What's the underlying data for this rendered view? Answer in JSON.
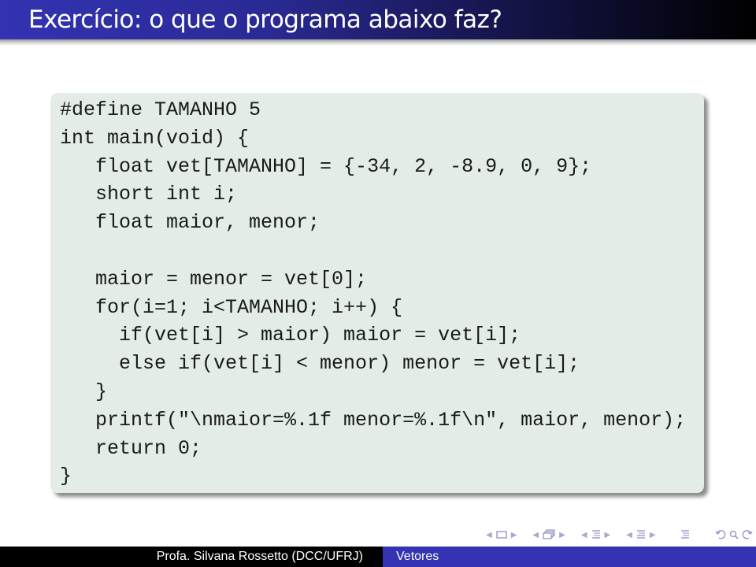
{
  "slide": {
    "title": "Exercício: o que o programa abaixo faz?",
    "code_lines": [
      "#define TAMANHO 5",
      "int main(void) {",
      "   float vet[TAMANHO] = {-34, 2, -8.9, 0, 9};",
      "   short int i;",
      "   float maior, menor;",
      "",
      "   maior = menor = vet[0];",
      "   for(i=1; i<TAMANHO; i++) {",
      "     if(vet[i] > maior) maior = vet[i];",
      "     else if(vet[i] < menor) menor = vet[i];",
      "   }",
      "   printf(\"\\nmaior=%.1f menor=%.1f\\n\", maior, menor);",
      "   return 0;",
      "}"
    ]
  },
  "navigation": {
    "icons": [
      "frame-icon",
      "subsection-icon",
      "section-icon",
      "document-icon",
      "outline-icon",
      "back-icon",
      "search-icon",
      "forward-icon"
    ]
  },
  "footer": {
    "author": "Profa. Silvana Rossetto (DCC/UFRJ)",
    "short_title": "Vetores"
  },
  "colors": {
    "title_bar": "#3333b3",
    "code_background": "#e3ede6",
    "footer_left": "#000000",
    "footer_right": "#3333b3"
  }
}
